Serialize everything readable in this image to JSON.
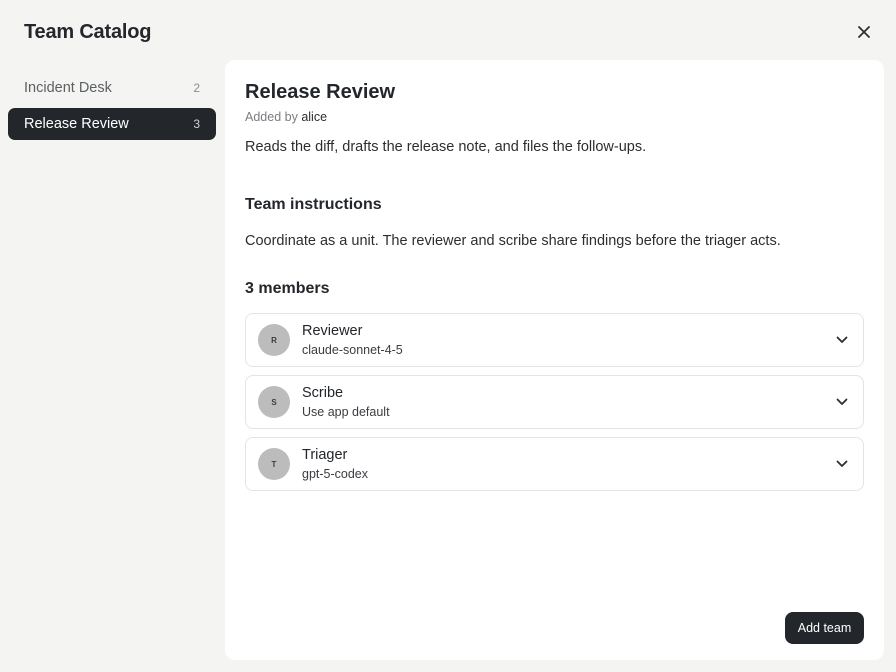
{
  "dialog": {
    "title": "Team Catalog",
    "close_icon": "close-icon"
  },
  "sidebar": {
    "items": [
      {
        "label": "Incident Desk",
        "count": "2",
        "active": false
      },
      {
        "label": "Release Review",
        "count": "3",
        "active": true
      }
    ]
  },
  "team": {
    "name": "Release Review",
    "added_by_prefix": "Added by",
    "added_by_author": "alice",
    "description": "Reads the diff, drafts the release note, and files the follow-ups.",
    "instructions_heading": "Team instructions",
    "instructions": "Coordinate as a unit. The reviewer and scribe share findings before the triager acts.",
    "members_heading": "3 members",
    "members": [
      {
        "initial": "R",
        "name": "Reviewer",
        "model": "claude-sonnet-4-5"
      },
      {
        "initial": "S",
        "name": "Scribe",
        "model": "Use app default"
      },
      {
        "initial": "T",
        "name": "Triager",
        "model": "gpt-5-codex"
      }
    ]
  },
  "actions": {
    "add_team_label": "Add team"
  },
  "colors": {
    "accent_dark": "#23272b",
    "background": "#f4f4f3",
    "panel": "#ffffff",
    "avatar": "#bcbcbc"
  }
}
